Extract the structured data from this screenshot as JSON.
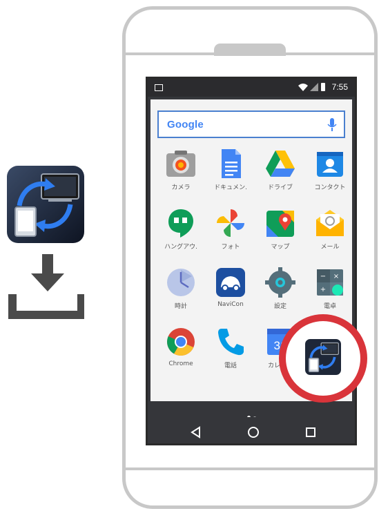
{
  "status_bar": {
    "time": "7:55"
  },
  "search": {
    "brand": "Google"
  },
  "apps": [
    {
      "label": "カメラ",
      "icon": "camera-icon"
    },
    {
      "label": "ドキュメン.",
      "icon": "docs-icon"
    },
    {
      "label": "ドライブ",
      "icon": "drive-icon"
    },
    {
      "label": "コンタクト",
      "icon": "contacts-icon"
    },
    {
      "label": "ハングアウ.",
      "icon": "hangouts-icon"
    },
    {
      "label": "フォト",
      "icon": "photos-icon"
    },
    {
      "label": "マップ",
      "icon": "maps-icon"
    },
    {
      "label": "メール",
      "icon": "email-icon"
    },
    {
      "label": "時計",
      "icon": "clock-icon"
    },
    {
      "label": "NaviCon",
      "icon": "navicon-icon"
    },
    {
      "label": "設定",
      "icon": "settings-icon"
    },
    {
      "label": "電卓",
      "icon": "calculator-icon"
    },
    {
      "label": "Chrome",
      "icon": "chrome-icon"
    },
    {
      "label": "電話",
      "icon": "phone-icon"
    },
    {
      "label": "カレンダ",
      "icon": "calendar-icon"
    }
  ],
  "calendar_day": "31",
  "highlighted_app": {
    "icon": "screen-mirroring-app-icon"
  },
  "colors": {
    "highlight": "#d9343a",
    "search_border": "#4a7fcf",
    "drawer_bg": "#f3f3f3",
    "screen_bg": "#35363a"
  }
}
